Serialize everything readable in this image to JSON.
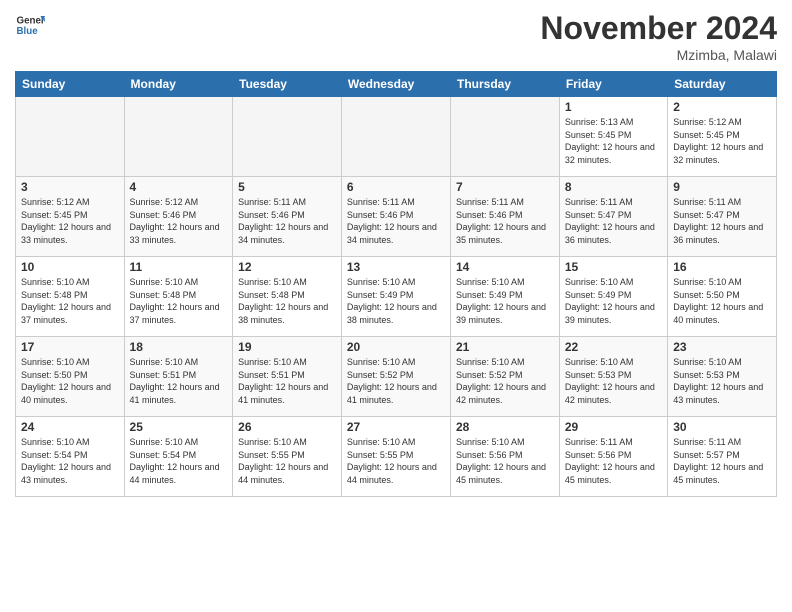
{
  "header": {
    "logo_general": "General",
    "logo_blue": "Blue",
    "month_title": "November 2024",
    "location": "Mzimba, Malawi"
  },
  "days_of_week": [
    "Sunday",
    "Monday",
    "Tuesday",
    "Wednesday",
    "Thursday",
    "Friday",
    "Saturday"
  ],
  "weeks": [
    [
      {
        "day": "",
        "empty": true
      },
      {
        "day": "",
        "empty": true
      },
      {
        "day": "",
        "empty": true
      },
      {
        "day": "",
        "empty": true
      },
      {
        "day": "",
        "empty": true
      },
      {
        "day": "1",
        "sunrise": "5:13 AM",
        "sunset": "5:45 PM",
        "daylight": "12 hours and 32 minutes"
      },
      {
        "day": "2",
        "sunrise": "5:12 AM",
        "sunset": "5:45 PM",
        "daylight": "12 hours and 32 minutes"
      }
    ],
    [
      {
        "day": "3",
        "sunrise": "5:12 AM",
        "sunset": "5:45 PM",
        "daylight": "12 hours and 33 minutes"
      },
      {
        "day": "4",
        "sunrise": "5:12 AM",
        "sunset": "5:46 PM",
        "daylight": "12 hours and 33 minutes"
      },
      {
        "day": "5",
        "sunrise": "5:11 AM",
        "sunset": "5:46 PM",
        "daylight": "12 hours and 34 minutes"
      },
      {
        "day": "6",
        "sunrise": "5:11 AM",
        "sunset": "5:46 PM",
        "daylight": "12 hours and 34 minutes"
      },
      {
        "day": "7",
        "sunrise": "5:11 AM",
        "sunset": "5:46 PM",
        "daylight": "12 hours and 35 minutes"
      },
      {
        "day": "8",
        "sunrise": "5:11 AM",
        "sunset": "5:47 PM",
        "daylight": "12 hours and 36 minutes"
      },
      {
        "day": "9",
        "sunrise": "5:11 AM",
        "sunset": "5:47 PM",
        "daylight": "12 hours and 36 minutes"
      }
    ],
    [
      {
        "day": "10",
        "sunrise": "5:10 AM",
        "sunset": "5:48 PM",
        "daylight": "12 hours and 37 minutes"
      },
      {
        "day": "11",
        "sunrise": "5:10 AM",
        "sunset": "5:48 PM",
        "daylight": "12 hours and 37 minutes"
      },
      {
        "day": "12",
        "sunrise": "5:10 AM",
        "sunset": "5:48 PM",
        "daylight": "12 hours and 38 minutes"
      },
      {
        "day": "13",
        "sunrise": "5:10 AM",
        "sunset": "5:49 PM",
        "daylight": "12 hours and 38 minutes"
      },
      {
        "day": "14",
        "sunrise": "5:10 AM",
        "sunset": "5:49 PM",
        "daylight": "12 hours and 39 minutes"
      },
      {
        "day": "15",
        "sunrise": "5:10 AM",
        "sunset": "5:49 PM",
        "daylight": "12 hours and 39 minutes"
      },
      {
        "day": "16",
        "sunrise": "5:10 AM",
        "sunset": "5:50 PM",
        "daylight": "12 hours and 40 minutes"
      }
    ],
    [
      {
        "day": "17",
        "sunrise": "5:10 AM",
        "sunset": "5:50 PM",
        "daylight": "12 hours and 40 minutes"
      },
      {
        "day": "18",
        "sunrise": "5:10 AM",
        "sunset": "5:51 PM",
        "daylight": "12 hours and 41 minutes"
      },
      {
        "day": "19",
        "sunrise": "5:10 AM",
        "sunset": "5:51 PM",
        "daylight": "12 hours and 41 minutes"
      },
      {
        "day": "20",
        "sunrise": "5:10 AM",
        "sunset": "5:52 PM",
        "daylight": "12 hours and 41 minutes"
      },
      {
        "day": "21",
        "sunrise": "5:10 AM",
        "sunset": "5:52 PM",
        "daylight": "12 hours and 42 minutes"
      },
      {
        "day": "22",
        "sunrise": "5:10 AM",
        "sunset": "5:53 PM",
        "daylight": "12 hours and 42 minutes"
      },
      {
        "day": "23",
        "sunrise": "5:10 AM",
        "sunset": "5:53 PM",
        "daylight": "12 hours and 43 minutes"
      }
    ],
    [
      {
        "day": "24",
        "sunrise": "5:10 AM",
        "sunset": "5:54 PM",
        "daylight": "12 hours and 43 minutes"
      },
      {
        "day": "25",
        "sunrise": "5:10 AM",
        "sunset": "5:54 PM",
        "daylight": "12 hours and 44 minutes"
      },
      {
        "day": "26",
        "sunrise": "5:10 AM",
        "sunset": "5:55 PM",
        "daylight": "12 hours and 44 minutes"
      },
      {
        "day": "27",
        "sunrise": "5:10 AM",
        "sunset": "5:55 PM",
        "daylight": "12 hours and 44 minutes"
      },
      {
        "day": "28",
        "sunrise": "5:10 AM",
        "sunset": "5:56 PM",
        "daylight": "12 hours and 45 minutes"
      },
      {
        "day": "29",
        "sunrise": "5:11 AM",
        "sunset": "5:56 PM",
        "daylight": "12 hours and 45 minutes"
      },
      {
        "day": "30",
        "sunrise": "5:11 AM",
        "sunset": "5:57 PM",
        "daylight": "12 hours and 45 minutes"
      }
    ]
  ]
}
